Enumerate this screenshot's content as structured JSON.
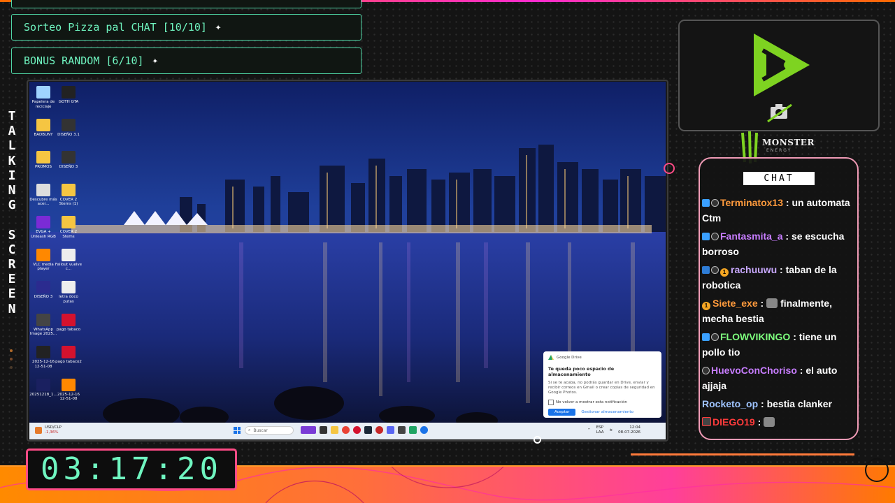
{
  "overlay": {
    "goals": [
      {
        "label": "Sorteo Pizza pal CHAT [10/10]",
        "icon": "sparkle-icon"
      },
      {
        "label": "BONUS RANDOM [6/10]",
        "icon": "sparkle-icon"
      }
    ],
    "side_title": "TALKING SCREEN",
    "timer": "03:17:20",
    "chat_header": "CHAT",
    "sponsor": {
      "name": "MONSTER",
      "sub": "ENERGY"
    },
    "accent_colors": {
      "goal": "#6ff5c0",
      "chat_border": "#f09bb6",
      "timer_border": "#ff4b86"
    }
  },
  "chat": {
    "messages": [
      {
        "user": "Terminatox13",
        "text": "un automata Ctm",
        "color": "#ff9a3c",
        "badges": [
          "cube",
          "bot"
        ]
      },
      {
        "user": "Fantasmita_a",
        "text": "se escucha borroso",
        "color": "#c77dff",
        "badges": [
          "cube",
          "bot"
        ]
      },
      {
        "user": "rachuuwu",
        "text": "taban de la robotica",
        "color": "#c9a9ff",
        "badges": [
          "prime",
          "bot",
          "gold"
        ]
      },
      {
        "user": "Siete_exe",
        "text": "finalmente, mecha bestia",
        "color": "#ff9a3c",
        "badges": [
          "gold"
        ],
        "emote": true
      },
      {
        "user": "FLOWVIKINGO",
        "text": "tiene un pollo tio",
        "color": "#7dff7d",
        "badges": [
          "cube",
          "bot"
        ]
      },
      {
        "user": "HuevoConChoriso",
        "text": "el auto ajjaja",
        "color": "#c77dff",
        "badges": [
          "bot"
        ]
      },
      {
        "user": "Rocketo_op",
        "text": "bestia clanker",
        "color": "#9fc4ff",
        "badges": []
      },
      {
        "user": "DIEGO19",
        "text": "",
        "color": "#ff3b3b",
        "badges": [
          "mod"
        ],
        "emote": true
      }
    ]
  },
  "desktop": {
    "icons": [
      {
        "label": "Papelera de reciclaje",
        "color": "#9fd3ff"
      },
      {
        "label": "GOTH GTA",
        "color": "#222"
      },
      {
        "label": "BADBUNY",
        "color": "#f5c542"
      },
      {
        "label": "DISEÑO 3.1",
        "color": "#333"
      },
      {
        "label": "PROMOS",
        "color": "#f5c542"
      },
      {
        "label": "DISEÑO 3",
        "color": "#333"
      },
      {
        "label": "Descubre más acer...",
        "color": "#ddd"
      },
      {
        "label": "COVER 2 Stems (1)",
        "color": "#f5c542"
      },
      {
        "label": "EVGA + Unleash RGB",
        "color": "#7b2bd6"
      },
      {
        "label": "COVER 2 Stems",
        "color": "#f5c542"
      },
      {
        "label": "VLC media player",
        "color": "#ff8800"
      },
      {
        "label": "Fallout vuelve c...",
        "color": "#eee"
      },
      {
        "label": "DISEÑO 3",
        "color": "#2b2b8f"
      },
      {
        "label": "letra doco putas",
        "color": "#eee"
      },
      {
        "label": "WhatsApp Image 2025...",
        "color": "#444"
      },
      {
        "label": "pago tabaco",
        "color": "#d4122e"
      },
      {
        "label": "2025-12-16 12-51-08",
        "color": "#222"
      },
      {
        "label": "pago tabaco2",
        "color": "#d4122e"
      },
      {
        "label": "20251218_1...",
        "color": "#1a2060"
      },
      {
        "label": "2025-12-16 12-51-08",
        "color": "#ff8800"
      }
    ],
    "popup": {
      "app": "Google Drive",
      "title": "Te queda poco espacio de almacenamiento",
      "body": "Si se te acaba, no podrás guardar en Drive, enviar y recibir correos en Gmail o crear copias de seguridad en Google Photos.",
      "checkbox": "No volver a mostrar esta notificación",
      "accept": "Aceptar",
      "manage": "Gestionar almacenamiento"
    },
    "taskbar": {
      "stock_name": "USD/CLP",
      "stock_change": "-1,36%",
      "search_placeholder": "Buscar",
      "lang": "ESP",
      "lang_sub": "LAA",
      "time": "12:04",
      "date": "08-07-2026"
    }
  }
}
